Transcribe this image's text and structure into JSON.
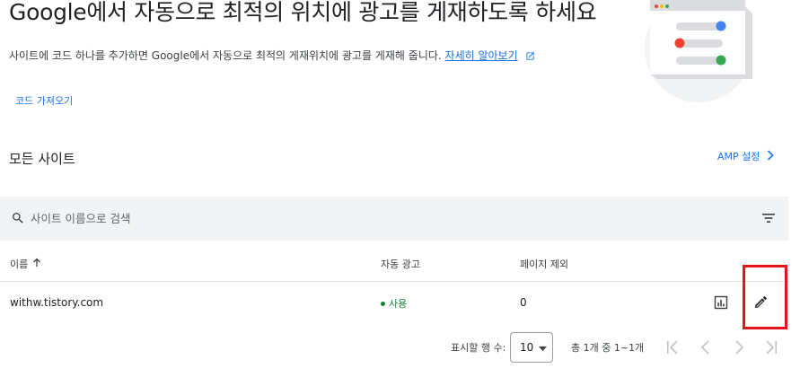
{
  "header": {
    "title": "Google에서 자동으로 최적의 위치에 광고를 게재하도록 하세요",
    "description": "사이트에 코드 하나를 추가하면 Google에서 자동으로 최적의 게재위치에 광고를 게재해 줍니다.",
    "learn_more": "자세히 알아보기",
    "get_code": "코드 가져오기"
  },
  "section": {
    "title": "모든 사이트",
    "amp_settings": "AMP 설정"
  },
  "search": {
    "placeholder": "사이트 이름으로 검색"
  },
  "table": {
    "columns": {
      "name": "이름",
      "auto_ads": "자동 광고",
      "page_exclusions": "페이지 제외"
    },
    "rows": [
      {
        "site": "withw.tistory.com",
        "auto_ads": "사용",
        "page_exclusions": "0"
      }
    ]
  },
  "pagination": {
    "rows_per_page_label": "표시할 행 수:",
    "rows_per_page": "10",
    "range": "총 1개 중 1~1개"
  },
  "colors": {
    "accent": "#1a73e8",
    "status_on": "#188038",
    "highlight": "#e5141b"
  },
  "icons": [
    "external-link-icon",
    "search-icon",
    "filter-icon",
    "sort-arrow-up-icon",
    "chevron-right-icon",
    "report-icon",
    "edit-pencil-icon",
    "first-page-icon",
    "prev-page-icon",
    "next-page-icon",
    "last-page-icon",
    "dropdown-arrow-icon"
  ]
}
